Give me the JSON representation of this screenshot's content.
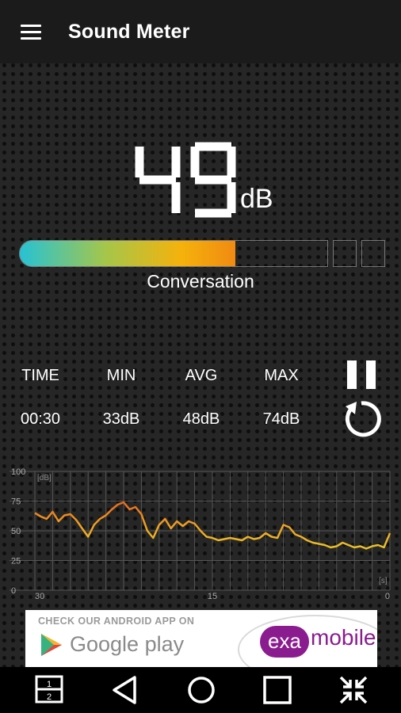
{
  "appbar": {
    "title": "Sound Meter",
    "menu_icon": "hamburger-menu-icon"
  },
  "reading": {
    "value": "49",
    "unit": "dB"
  },
  "level": {
    "fraction": 0.59,
    "label": "Conversation"
  },
  "stats": {
    "headers": [
      "TIME",
      "MIN",
      "AVG",
      "MAX"
    ],
    "values": [
      "00:30",
      "33dB",
      "48dB",
      "74dB"
    ]
  },
  "controls": {
    "pause_icon": "pause-icon",
    "reset_icon": "reset-icon"
  },
  "graph": {
    "y_ticks": [
      "100",
      "75",
      "50",
      "25",
      "0"
    ],
    "y_unit": "[dB]",
    "x_ticks": [
      "30",
      "15",
      "0"
    ],
    "x_unit": "[s]"
  },
  "chart_data": {
    "type": "line",
    "ylim": [
      0,
      100
    ],
    "xlim": [
      30,
      0
    ],
    "x": [
      30,
      29.5,
      29,
      28.5,
      28,
      27.5,
      27,
      26.5,
      26,
      25.5,
      25,
      24.5,
      24,
      23.5,
      23,
      22.5,
      22,
      21.5,
      21,
      20.5,
      20,
      19.5,
      19,
      18.5,
      18,
      17.5,
      17,
      16.5,
      16,
      15.5,
      15,
      14.5,
      14,
      13.5,
      13,
      12.5,
      12,
      11.5,
      11,
      10.5,
      10,
      9.5,
      9,
      8.5,
      8,
      7.5,
      7,
      6.5,
      6,
      5.5,
      5,
      4.5,
      4,
      3.5,
      3,
      2.5,
      2,
      1.5,
      1,
      0.5,
      0
    ],
    "values": [
      65,
      62,
      60,
      66,
      58,
      63,
      64,
      59,
      52,
      45,
      55,
      60,
      63,
      68,
      72,
      74,
      68,
      70,
      64,
      50,
      44,
      55,
      60,
      52,
      58,
      54,
      58,
      56,
      50,
      45,
      44,
      42,
      43,
      44,
      43,
      42,
      45,
      43,
      44,
      48,
      45,
      44,
      55,
      53,
      47,
      45,
      42,
      40,
      39,
      38,
      36,
      37,
      40,
      38,
      36,
      37,
      35,
      37,
      38,
      36,
      48
    ],
    "colors": {
      "low": "#e6cf2a",
      "mid": "#f0a020",
      "high": "#e03a18"
    }
  },
  "ad": {
    "header": "CHECK OUR ANDROID APP ON",
    "store": "Google play",
    "brand_badge": "exa",
    "brand_name": "mobile"
  },
  "navbar": {
    "icons": [
      "dual-window-icon",
      "back-icon",
      "home-icon",
      "recents-icon",
      "collapse-icon"
    ]
  }
}
